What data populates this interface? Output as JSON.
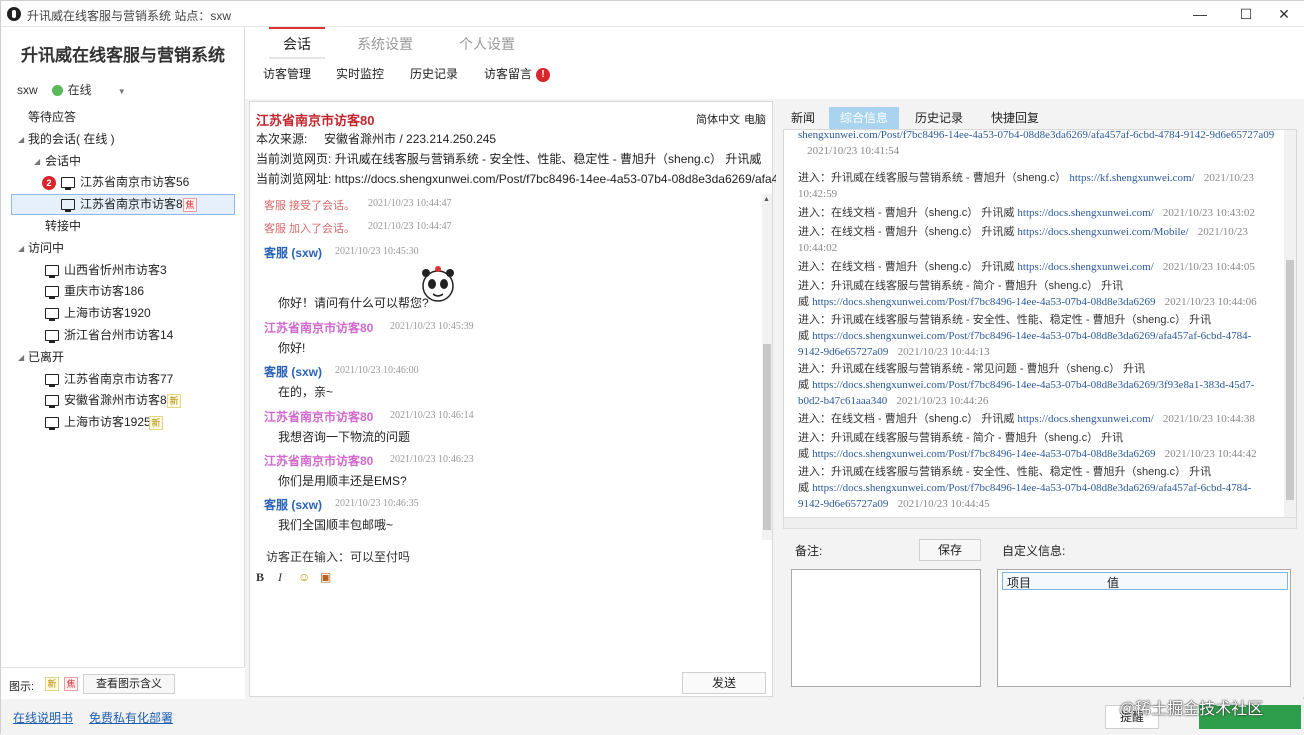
{
  "window": {
    "title": "升讯威在线客服与营销系统  站点：sxw",
    "minimize": "—",
    "maximize": "☐",
    "close": "✕"
  },
  "brand": "升讯威在线客服与营销系统",
  "user": {
    "name": "sxw",
    "status": "在线",
    "status_color": "#5cb85c"
  },
  "tree": {
    "waiting": "等待应答",
    "my_sessions": "我的会话( 在线 )",
    "in_session": "会话中",
    "session_items": [
      {
        "label": "江苏省南京市访客56",
        "badge": "2"
      },
      {
        "label": "江苏省南京市访客80",
        "tag": "焦"
      }
    ],
    "transferring": "转接中",
    "visiting": "访问中",
    "visiting_items": [
      "山西省忻州市访客3",
      "重庆市访客186",
      "上海市访客1920",
      "浙江省台州市访客14"
    ],
    "left": "已离开",
    "left_items": [
      {
        "label": "江苏省南京市访客77"
      },
      {
        "label": "安徽省滁州市访客82",
        "tag": "新"
      },
      {
        "label": "上海市访客1925",
        "tag": "新"
      }
    ]
  },
  "legend": {
    "label": "图示:",
    "new_tag": "新",
    "focus_tag": "焦",
    "button": "查看图示含义"
  },
  "footer": {
    "manual": "在线说明书",
    "deploy": "免费私有化部署",
    "button1": "提醒",
    "watermark": "@稀土掘金技术社区"
  },
  "main_tabs": [
    "会话",
    "系统设置",
    "个人设置"
  ],
  "sub_tabs": {
    "items": [
      "访客管理",
      "实时监控",
      "历史记录",
      "访客留言"
    ],
    "alert": "!"
  },
  "visitor": {
    "name": "江苏省南京市访客80",
    "lang": "简体中文",
    "device": "电脑",
    "source_label": "本次来源:",
    "source_value": "安徽省滁州市  /  223.214.250.245",
    "page_label": "当前浏览网页:",
    "page_value": "升讯威在线客服与营销系统 - 安全性、性能、稳定性 - 曹旭升（sheng.c） 升讯威",
    "url_label": "当前浏览网址:",
    "url_value": "https://docs.shengxunwei.com/Post/f7bc8496-14ee-4a53-07b4-08d8e3da6269/afa4"
  },
  "messages": {
    "sys1": "客服 接受了会话。",
    "sys1_time": "2021/10/23 10:44:47",
    "sys2": "客服 加入了会话。",
    "sys2_time": "2021/10/23 10:44:47",
    "m1_from": "客服 (sxw)",
    "m1_time": "2021/10/23 10:45:30",
    "m1_text": "你好！请问有什么可以帮您?",
    "m2_from": "江苏省南京市访客80",
    "m2_time": "2021/10/23 10:45:39",
    "m2_text": "你好!",
    "m3_from": "客服 (sxw)",
    "m3_time": "2021/10/23 10:46:00",
    "m3_text": "在的，亲~",
    "m4_from": "江苏省南京市访客80",
    "m4_time": "2021/10/23 10:46:14",
    "m4_text": "我想咨询一下物流的问题",
    "m5_from": "江苏省南京市访客80",
    "m5_time": "2021/10/23 10:46:23",
    "m5_text": "你们是用顺丰还是EMS?",
    "m6_from": "客服 (sxw)",
    "m6_time": "2021/10/23 10:46:35",
    "m6_text": "我们全国顺丰包邮哦~"
  },
  "typing": "访客正在输入：可以至付吗",
  "format": {
    "bold": "B",
    "italic": "I",
    "emoji": "☺",
    "image": "▣"
  },
  "send": "发送",
  "right_tabs": [
    "新闻",
    "综合信息",
    "历史记录",
    "快捷回复"
  ],
  "logs": [
    {
      "text": "",
      "url": "shengxunwei.com/Post/f7bc8496-14ee-4a53-07b4-08d8e3da6269/afa457af-6cbd-4784-9142-9d6e65727a09",
      "time": "2021/10/23 10:41:54"
    },
    {
      "text": "进入：升讯威在线客服与营销系统 - 曹旭升（sheng.c）",
      "url": "https://kf.shengxunwei.com/",
      "time": "2021/10/23 10:42:59"
    },
    {
      "text": "进入：在线文档 - 曹旭升（sheng.c） 升讯威",
      "url": "https://docs.shengxunwei.com/",
      "time": "2021/10/23 10:43:02"
    },
    {
      "text": "进入：在线文档 - 曹旭升（sheng.c） 升讯威",
      "url": "https://docs.shengxunwei.com/Mobile/",
      "time": "2021/10/23 10:44:02"
    },
    {
      "text": "进入：在线文档 - 曹旭升（sheng.c） 升讯威",
      "url": "https://docs.shengxunwei.com/",
      "time": "2021/10/23 10:44:05"
    },
    {
      "text": "进入：升讯威在线客服与营销系统 - 简介 - 曹旭升（sheng.c） 升讯威",
      "url": "https://docs.shengxunwei.com/Post/f7bc8496-14ee-4a53-07b4-08d8e3da6269",
      "time": "2021/10/23 10:44:06"
    },
    {
      "text": "进入：升讯威在线客服与营销系统 - 安全性、性能、稳定性 - 曹旭升（sheng.c） 升讯威",
      "url": "https://docs.shengxunwei.com/Post/f7bc8496-14ee-4a53-07b4-08d8e3da6269/afa457af-6cbd-4784-9142-9d6e65727a09",
      "time": "2021/10/23 10:44:13"
    },
    {
      "text": "进入：升讯威在线客服与营销系统 - 常见问题 - 曹旭升（sheng.c） 升讯威",
      "url": "https://docs.shengxunwei.com/Post/f7bc8496-14ee-4a53-07b4-08d8e3da6269/3f93e8a1-383d-45d7-b0d2-b47c61aaa340",
      "time": "2021/10/23 10:44:26"
    },
    {
      "text": "进入：在线文档 - 曹旭升（sheng.c） 升讯威",
      "url": "https://docs.shengxunwei.com/",
      "time": "2021/10/23 10:44:38"
    },
    {
      "text": "进入：升讯威在线客服与营销系统 - 简介 - 曹旭升（sheng.c） 升讯威",
      "url": "https://docs.shengxunwei.com/Post/f7bc8496-14ee-4a53-07b4-08d8e3da6269",
      "time": "2021/10/23 10:44:42"
    },
    {
      "text": "进入：升讯威在线客服与营销系统 - 安全性、性能、稳定性 - 曹旭升（sheng.c） 升讯威",
      "url": "https://docs.shengxunwei.com/Post/f7bc8496-14ee-4a53-07b4-08d8e3da6269/afa457af-6cbd-4784-9142-9d6e65727a09",
      "time": "2021/10/23 10:44:45"
    }
  ],
  "notes": {
    "label": "备注:",
    "save": "保存",
    "custom_label": "自定义信息:",
    "col_item": "项目",
    "col_value": "值"
  }
}
